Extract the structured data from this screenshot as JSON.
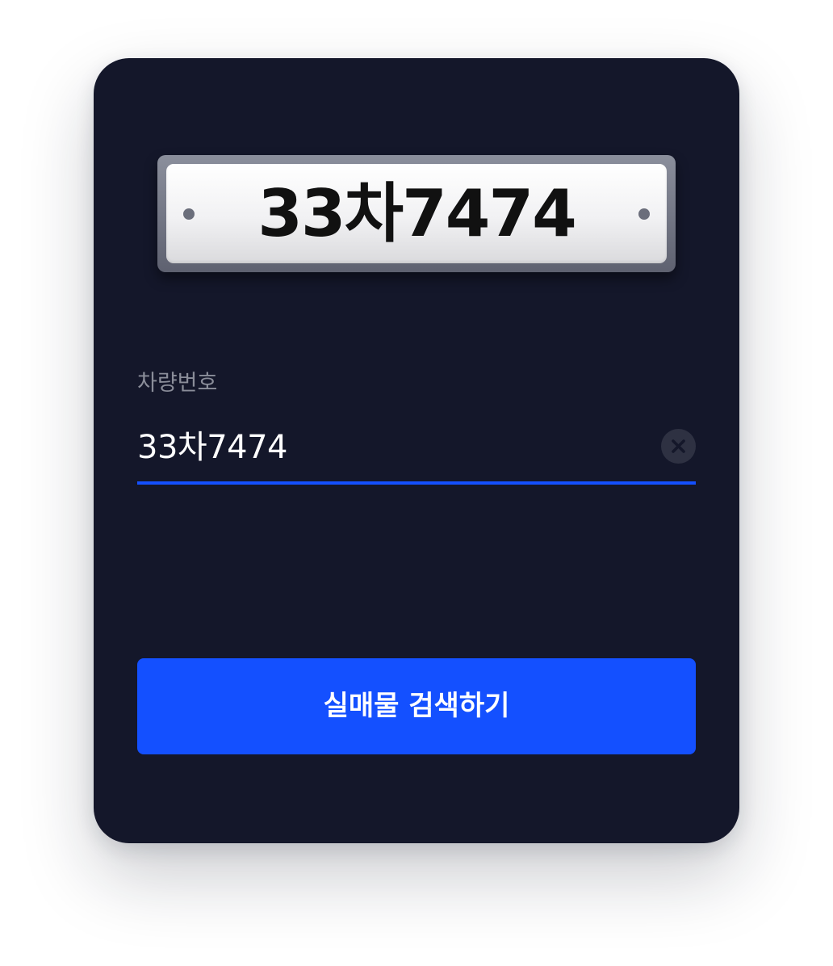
{
  "plate": {
    "number": "33차7474"
  },
  "form": {
    "label": "차량번호",
    "value": "33차7474",
    "clear_icon": "close-icon"
  },
  "action": {
    "search_label": "실매물 검색하기"
  },
  "colors": {
    "card_background": "#14172a",
    "accent": "#1450ff",
    "label": "#8a8d99",
    "clear_button": "#2e3142"
  }
}
